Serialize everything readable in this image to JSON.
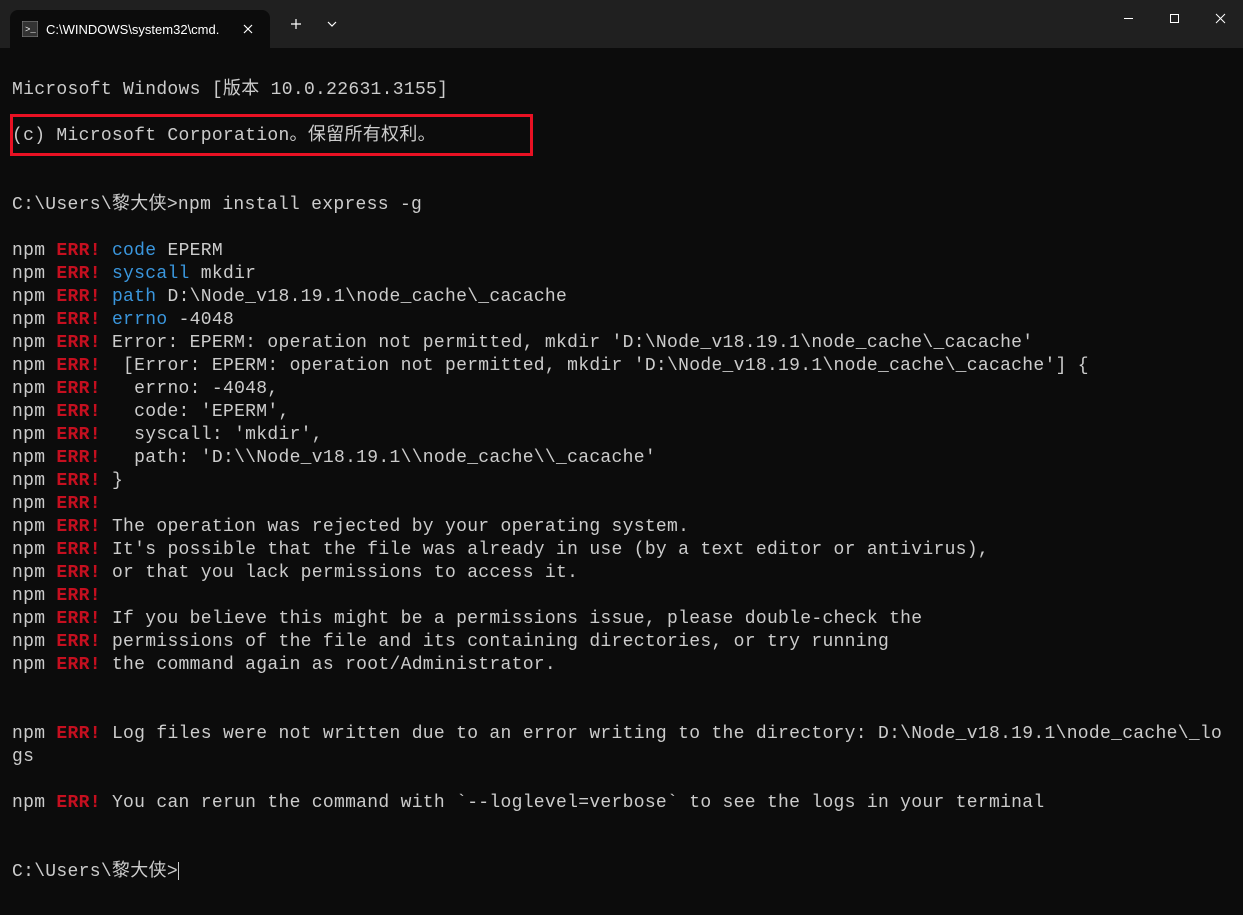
{
  "titlebar": {
    "tab": {
      "title": "C:\\WINDOWS\\system32\\cmd."
    }
  },
  "terminal": {
    "line1": "Microsoft Windows [版本 10.0.22631.3155]",
    "line2": "(c) Microsoft Corporation。保留所有权利。",
    "blank1": "",
    "prompt1": "C:\\Users\\黎大侠>npm install express -g",
    "err_lines": [
      {
        "parts": [
          {
            "type": "npm",
            "text": "npm "
          },
          {
            "type": "err",
            "text": "ERR!"
          },
          {
            "type": "cyan",
            "text": " code"
          },
          {
            "type": "plain",
            "text": " EPERM"
          }
        ]
      },
      {
        "parts": [
          {
            "type": "npm",
            "text": "npm "
          },
          {
            "type": "err",
            "text": "ERR!"
          },
          {
            "type": "cyan",
            "text": " syscall"
          },
          {
            "type": "plain",
            "text": " mkdir"
          }
        ]
      },
      {
        "parts": [
          {
            "type": "npm",
            "text": "npm "
          },
          {
            "type": "err",
            "text": "ERR!"
          },
          {
            "type": "cyan",
            "text": " path"
          },
          {
            "type": "plain",
            "text": " D:\\Node_v18.19.1\\node_cache\\_cacache"
          }
        ]
      },
      {
        "parts": [
          {
            "type": "npm",
            "text": "npm "
          },
          {
            "type": "err",
            "text": "ERR!"
          },
          {
            "type": "cyan",
            "text": " errno"
          },
          {
            "type": "plain",
            "text": " -4048"
          }
        ]
      },
      {
        "parts": [
          {
            "type": "npm",
            "text": "npm "
          },
          {
            "type": "err",
            "text": "ERR!"
          },
          {
            "type": "plain",
            "text": " Error: EPERM: operation not permitted, mkdir 'D:\\Node_v18.19.1\\node_cache\\_cacache'"
          }
        ]
      },
      {
        "parts": [
          {
            "type": "npm",
            "text": "npm "
          },
          {
            "type": "err",
            "text": "ERR!"
          },
          {
            "type": "plain",
            "text": "  [Error: EPERM: operation not permitted, mkdir 'D:\\Node_v18.19.1\\node_cache\\_cacache'] {"
          }
        ]
      },
      {
        "parts": [
          {
            "type": "npm",
            "text": "npm "
          },
          {
            "type": "err",
            "text": "ERR!"
          },
          {
            "type": "plain",
            "text": "   errno: -4048,"
          }
        ]
      },
      {
        "parts": [
          {
            "type": "npm",
            "text": "npm "
          },
          {
            "type": "err",
            "text": "ERR!"
          },
          {
            "type": "plain",
            "text": "   code: 'EPERM',"
          }
        ]
      },
      {
        "parts": [
          {
            "type": "npm",
            "text": "npm "
          },
          {
            "type": "err",
            "text": "ERR!"
          },
          {
            "type": "plain",
            "text": "   syscall: 'mkdir',"
          }
        ]
      },
      {
        "parts": [
          {
            "type": "npm",
            "text": "npm "
          },
          {
            "type": "err",
            "text": "ERR!"
          },
          {
            "type": "plain",
            "text": "   path: 'D:\\\\Node_v18.19.1\\\\node_cache\\\\_cacache'"
          }
        ]
      },
      {
        "parts": [
          {
            "type": "npm",
            "text": "npm "
          },
          {
            "type": "err",
            "text": "ERR!"
          },
          {
            "type": "plain",
            "text": " }"
          }
        ]
      },
      {
        "parts": [
          {
            "type": "npm",
            "text": "npm "
          },
          {
            "type": "err",
            "text": "ERR!"
          },
          {
            "type": "plain",
            "text": ""
          }
        ]
      },
      {
        "parts": [
          {
            "type": "npm",
            "text": "npm "
          },
          {
            "type": "err",
            "text": "ERR!"
          },
          {
            "type": "plain",
            "text": " The operation was rejected by your operating system."
          }
        ]
      },
      {
        "parts": [
          {
            "type": "npm",
            "text": "npm "
          },
          {
            "type": "err",
            "text": "ERR!"
          },
          {
            "type": "plain",
            "text": " It's possible that the file was already in use (by a text editor or antivirus),"
          }
        ]
      },
      {
        "parts": [
          {
            "type": "npm",
            "text": "npm "
          },
          {
            "type": "err",
            "text": "ERR!"
          },
          {
            "type": "plain",
            "text": " or that you lack permissions to access it."
          }
        ]
      },
      {
        "parts": [
          {
            "type": "npm",
            "text": "npm "
          },
          {
            "type": "err",
            "text": "ERR!"
          },
          {
            "type": "plain",
            "text": ""
          }
        ]
      },
      {
        "parts": [
          {
            "type": "npm",
            "text": "npm "
          },
          {
            "type": "err",
            "text": "ERR!"
          },
          {
            "type": "plain",
            "text": " If you believe this might be a permissions issue, please double-check the"
          }
        ]
      },
      {
        "parts": [
          {
            "type": "npm",
            "text": "npm "
          },
          {
            "type": "err",
            "text": "ERR!"
          },
          {
            "type": "plain",
            "text": " permissions of the file and its containing directories, or try running"
          }
        ]
      },
      {
        "parts": [
          {
            "type": "npm",
            "text": "npm "
          },
          {
            "type": "err",
            "text": "ERR!"
          },
          {
            "type": "plain",
            "text": " the command again as root/Administrator."
          }
        ]
      }
    ],
    "blank2": "",
    "log_line1_pre": "npm ",
    "log_line1_err": "ERR!",
    "log_line1_post": " Log files were not written due to an error writing to the directory: D:\\Node_v18.19.1\\node_cache\\_logs",
    "log_line2_pre": "npm ",
    "log_line2_err": "ERR!",
    "log_line2_post": " You can rerun the command with `--loglevel=verbose` to see the logs in your terminal",
    "blank3": "",
    "prompt2": "C:\\Users\\黎大侠>"
  }
}
